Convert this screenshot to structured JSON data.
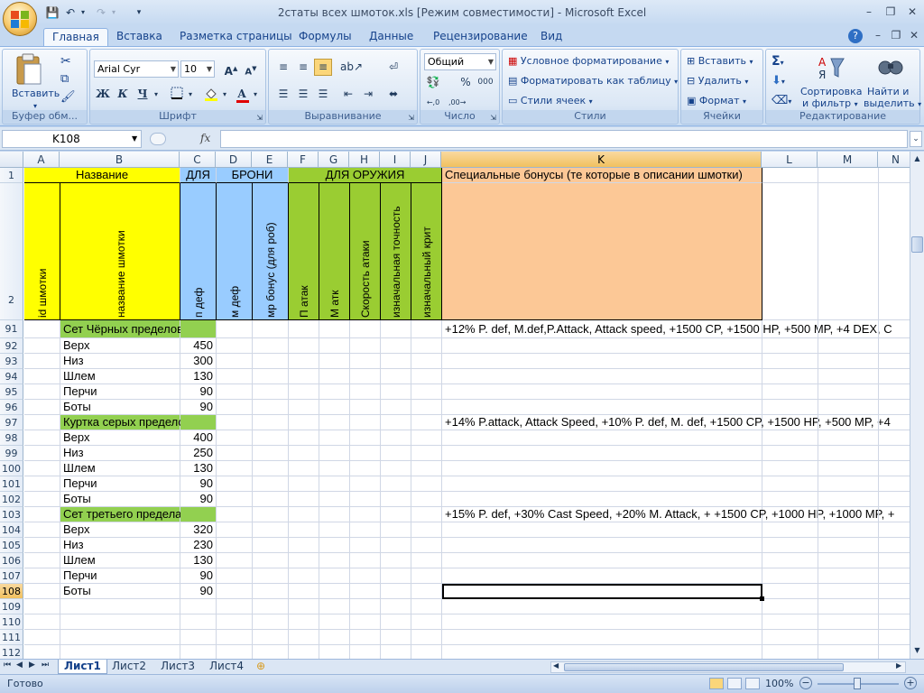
{
  "window": {
    "title": "2статы всех шмоток.xls  [Режим совместимости] - Microsoft Excel",
    "min": "–",
    "max": "❐",
    "close": "✕"
  },
  "tabs": [
    "Главная",
    "Вставка",
    "Разметка страницы",
    "Формулы",
    "Данные",
    "Рецензирование",
    "Вид"
  ],
  "ribbon": {
    "clipboard": {
      "paste": "Вставить",
      "label": "Буфер обм..."
    },
    "font": {
      "name": "Arial Cyr",
      "size": "10",
      "bold": "Ж",
      "italic": "К",
      "underline": "Ч",
      "label": "Шрифт"
    },
    "alignment": {
      "label": "Выравнивание"
    },
    "number": {
      "format": "Общий",
      "percent": "%",
      "thousands": "000",
      "label": "Число"
    },
    "styles": {
      "conditional": "Условное форматирование",
      "as_table": "Форматировать как таблицу",
      "cell_styles": "Стили ячеек",
      "label": "Стили"
    },
    "cells": {
      "insert": "Вставить",
      "delete": "Удалить",
      "format": "Формат",
      "label": "Ячейки"
    },
    "editing": {
      "sort1": "Сортировка",
      "sort2": "и фильтр",
      "find1": "Найти и",
      "find2": "выделить",
      "label": "Редактирование"
    }
  },
  "formula": {
    "namebox": "K108",
    "fx": "fx",
    "value": ""
  },
  "columns": [
    "A",
    "B",
    "C",
    "D",
    "E",
    "F",
    "G",
    "H",
    "I",
    "J",
    "K",
    "L",
    "M",
    "N"
  ],
  "header": {
    "r1": {
      "name": "Название",
      "armor1": "ДЛЯ",
      "armor2": "БРОНИ",
      "weapon": "ДЛЯ ОРУЖИЯ",
      "special": "Специальные бонусы (те которые в описании шмотки)"
    },
    "r2": [
      "id шмотки",
      "название шмотки",
      "п деф",
      "м деф",
      "мр бонус (для роб)",
      "П атак",
      "М атк",
      "Скорость атаки",
      "изначальная точность",
      "изначальный крит"
    ]
  },
  "rows": [
    {
      "n": "91",
      "b": "Сет Чёрных пределов",
      "c": "",
      "k": "+12% P. def, M.def,P.Attack, Attack speed, +1500 CP, +1500 HP, +500 MP, +4 DEX, C",
      "set": true
    },
    {
      "n": "92",
      "b": "Верх",
      "c": "450",
      "k": ""
    },
    {
      "n": "93",
      "b": "Низ",
      "c": "300",
      "k": ""
    },
    {
      "n": "94",
      "b": "Шлем",
      "c": "130",
      "k": ""
    },
    {
      "n": "95",
      "b": "Перчи",
      "c": "90",
      "k": ""
    },
    {
      "n": "96",
      "b": "Боты",
      "c": "90",
      "k": ""
    },
    {
      "n": "97",
      "b": "Куртка серых пределов",
      "c": "",
      "k": " +14% P.attack, Attack Speed, +10% P. def, M. def, +1500 CP, +1500 HP, +500 MP, +4",
      "set": true
    },
    {
      "n": "98",
      "b": "Верх",
      "c": "400",
      "k": ""
    },
    {
      "n": "99",
      "b": "Низ",
      "c": "250",
      "k": ""
    },
    {
      "n": "100",
      "b": "Шлем",
      "c": "130",
      "k": ""
    },
    {
      "n": "101",
      "b": "Перчи",
      "c": "90",
      "k": ""
    },
    {
      "n": "102",
      "b": "Боты",
      "c": "90",
      "k": ""
    },
    {
      "n": "103",
      "b": "Сет третьего предела",
      "c": "",
      "k": " +15% P. def, +30% Cast Speed, +20% M. Attack, + +1500 CP, +1000 HP, +1000 MP, +",
      "set": true
    },
    {
      "n": "104",
      "b": "Верх",
      "c": "320",
      "k": ""
    },
    {
      "n": "105",
      "b": "Низ",
      "c": "230",
      "k": ""
    },
    {
      "n": "106",
      "b": "Шлем",
      "c": "130",
      "k": ""
    },
    {
      "n": "107",
      "b": "Перчи",
      "c": "90",
      "k": ""
    },
    {
      "n": "108",
      "b": "Боты",
      "c": "90",
      "k": "",
      "sel": true
    },
    {
      "n": "109",
      "b": "",
      "c": "",
      "k": ""
    },
    {
      "n": "110",
      "b": "",
      "c": "",
      "k": ""
    },
    {
      "n": "111",
      "b": "",
      "c": "",
      "k": ""
    },
    {
      "n": "112",
      "b": "",
      "c": "",
      "k": ""
    }
  ],
  "sheets": [
    "Лист1",
    "Лист2",
    "Лист3",
    "Лист4"
  ],
  "status": {
    "ready": "Готово",
    "zoom": "100%"
  }
}
